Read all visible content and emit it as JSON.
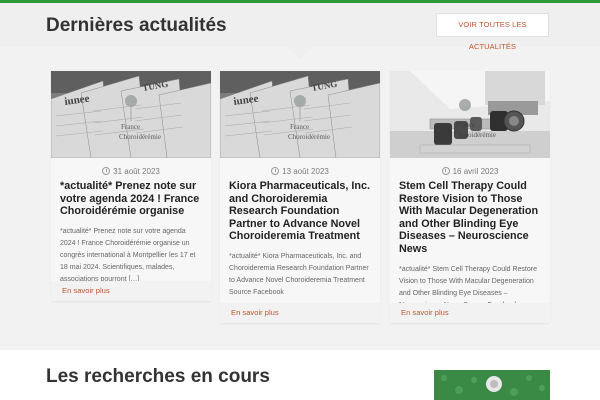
{
  "news": {
    "title": "Dernières actualités",
    "see_all_label": "VOIR TOUTES LES ACTUALITÉS",
    "articles": [
      {
        "date": "31 août 2023",
        "title": "*actualité* Prenez note sur votre agenda 2024 ! France Choroidérémie organise",
        "excerpt": "*actualité* Prenez note sur votre agenda 2024 ! France Choroidérémie organise un congrès international à Montpellier les 17 et 18 mai 2024. Scientifiques, malades, associations pourront […]",
        "more": "En savoir plus",
        "image_icon": "newspapers-image"
      },
      {
        "date": "13 août 2023",
        "title": "Kiora Pharmaceuticals, Inc. and Choroideremia Research Foundation Partner to Advance Novel Choroideremia Treatment",
        "excerpt": "*actualité* Kiora Pharmaceuticals, Inc. and Choroideremia Research Foundation Partner to Advance Novel Choroideremia Treatment Source Facebook",
        "more": "En savoir plus",
        "image_icon": "newspapers-image"
      },
      {
        "date": "16 avril 2023",
        "title": "Stem Cell Therapy Could Restore Vision to Those With Macular Degeneration and Other Blinding Eye Diseases – Neuroscience News",
        "excerpt": "*actualité* Stem Cell Therapy Could Restore Vision to Those With Macular Degeneration and Other Blinding Eye Diseases – Neuroscience News Source Facebook",
        "more": "En savoir plus",
        "image_icon": "microscope-image"
      }
    ],
    "watermark_text": "France Choroidérémie"
  },
  "research": {
    "title": "Les recherches en cours",
    "image_icon": "research-green-image"
  },
  "colors": {
    "accent": "#c0562f",
    "topline": "#2e9b3a",
    "research_image": "#3a8a45"
  }
}
